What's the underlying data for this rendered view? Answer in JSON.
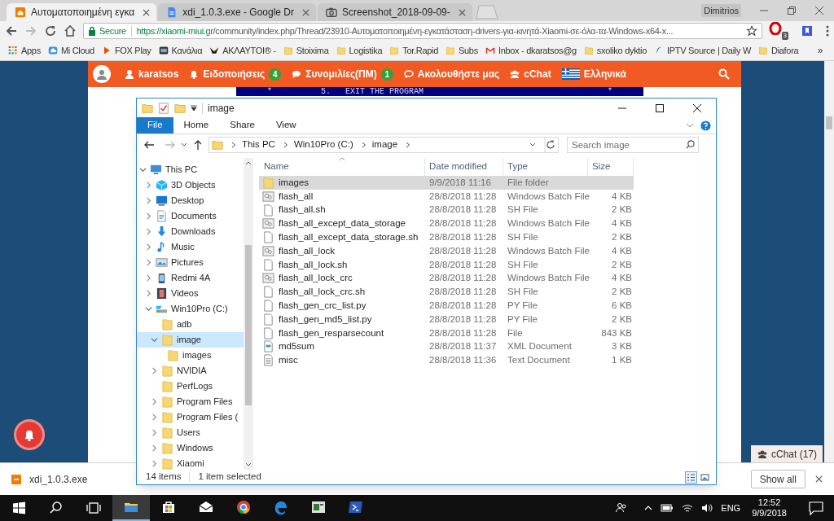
{
  "browser": {
    "tabs": [
      {
        "kind": "site",
        "title": "Αυτοματοποιημένη εγκα",
        "selected": true
      },
      {
        "kind": "document",
        "title": "xdi_1.0.3.exe - Google Dr",
        "selected": false
      },
      {
        "kind": "image",
        "title": "Screenshot_2018-09-09-",
        "selected": false
      }
    ],
    "profile": "Dimitrios",
    "security_label": "Secure",
    "url_host": "https://xiaomi-miui.gr",
    "url_path": "/community/index.php/Thread/23910-Αυτοματοποιημένη-εγκατάσταση-drivers-για-κινητά-Xiaomi-σε-όλα-τα-Windows-x64-x...",
    "extension_badge": "3",
    "bookmarks": [
      {
        "kind": "apps",
        "label": "Apps"
      },
      {
        "kind": "cloud",
        "label": "Mi Cloud"
      },
      {
        "kind": "play",
        "label": "FOX Play"
      },
      {
        "kind": "channel",
        "label": "Κανάλια"
      },
      {
        "kind": "bird",
        "label": "ΑΚΛΑΥΤΟΙ® -"
      },
      {
        "kind": "folder",
        "label": "Stoixima"
      },
      {
        "kind": "folder",
        "label": "Logistika"
      },
      {
        "kind": "folder",
        "label": "Tor.Rapid"
      },
      {
        "kind": "folder",
        "label": "Subs"
      },
      {
        "kind": "mail",
        "label": "Inbox - dkaratsos@g"
      },
      {
        "kind": "folder",
        "label": "sxoliko dyktio"
      },
      {
        "kind": "wave",
        "label": "IPTV Source | Daily W"
      },
      {
        "kind": "folder",
        "label": "Diafora"
      }
    ],
    "bookmarks_more": "»"
  },
  "site_nav": {
    "items": [
      {
        "kind": "user",
        "label": "karatsos"
      },
      {
        "kind": "bell",
        "label": "Ειδοποιήσεις",
        "badge": "4"
      },
      {
        "kind": "chat",
        "label": "Συνομιλίες(ΠΜ)",
        "badge": "1"
      },
      {
        "kind": "follow",
        "label": "Ακολουθήστε μας"
      },
      {
        "kind": "group",
        "label": "cChat"
      },
      {
        "kind": "flag",
        "label": "Ελληνικά"
      }
    ]
  },
  "terminal_line": {
    "left": "*",
    "text": "5.   EXIT THE PROGRAM",
    "right": "*"
  },
  "explorer": {
    "title": "image",
    "ribbon_tabs": [
      {
        "label": "File",
        "selected": true
      },
      {
        "label": "Home",
        "selected": false
      },
      {
        "label": "Share",
        "selected": false
      },
      {
        "label": "View",
        "selected": false
      }
    ],
    "breadcrumb": [
      "This PC",
      "Win10Pro (C:)",
      "image"
    ],
    "search": {
      "placeholder": "Search image"
    },
    "tree": [
      {
        "kind": "pc",
        "label": "This PC",
        "expandable": true,
        "expanded": true,
        "selected": false,
        "children": [
          {
            "kind": "objects",
            "label": "3D Objects",
            "expandable": true,
            "expanded": false,
            "selected": false
          },
          {
            "kind": "desktop",
            "label": "Desktop",
            "expandable": true,
            "expanded": false,
            "selected": false
          },
          {
            "kind": "documents",
            "label": "Documents",
            "expandable": true,
            "expanded": false,
            "selected": false
          },
          {
            "kind": "downloads",
            "label": "Downloads",
            "expandable": true,
            "expanded": false,
            "selected": false
          },
          {
            "kind": "music",
            "label": "Music",
            "expandable": true,
            "expanded": false,
            "selected": false
          },
          {
            "kind": "pictures",
            "label": "Pictures",
            "expandable": true,
            "expanded": false,
            "selected": false
          },
          {
            "kind": "phone",
            "label": "Redmi 4A",
            "expandable": true,
            "expanded": false,
            "selected": false
          },
          {
            "kind": "videos",
            "label": "Videos",
            "expandable": true,
            "expanded": false,
            "selected": false
          },
          {
            "kind": "drive",
            "label": "Win10Pro (C:)",
            "expandable": true,
            "expanded": true,
            "selected": false,
            "children": [
              {
                "kind": "folder",
                "label": "adb",
                "expandable": false,
                "selected": false
              },
              {
                "kind": "folder",
                "label": "image",
                "expandable": true,
                "expanded": true,
                "selected": true,
                "children": [
                  {
                    "kind": "folder",
                    "label": "images",
                    "expandable": false,
                    "selected": false
                  }
                ]
              },
              {
                "kind": "folder",
                "label": "NVIDIA",
                "expandable": true,
                "expanded": false,
                "selected": false
              },
              {
                "kind": "folder",
                "label": "PerfLogs",
                "expandable": false,
                "selected": false
              },
              {
                "kind": "folder",
                "label": "Program Files",
                "expandable": true,
                "expanded": false,
                "selected": false
              },
              {
                "kind": "folder",
                "label": "Program Files (",
                "expandable": true,
                "expanded": false,
                "selected": false
              },
              {
                "kind": "folder",
                "label": "Users",
                "expandable": true,
                "expanded": false,
                "selected": false
              },
              {
                "kind": "folder",
                "label": "Windows",
                "expandable": true,
                "expanded": false,
                "selected": false
              },
              {
                "kind": "folder",
                "label": "Xiaomi",
                "expandable": true,
                "expanded": false,
                "selected": false
              }
            ]
          }
        ]
      }
    ],
    "columns": [
      "Name",
      "Date modified",
      "Type",
      "Size"
    ],
    "rows": [
      {
        "kind": "folder",
        "name": "images",
        "date": "9/9/2018 11:16",
        "type": "File folder",
        "size": "",
        "selected": true
      },
      {
        "kind": "batch",
        "name": "flash_all",
        "date": "28/8/2018 11:28",
        "type": "Windows Batch File",
        "size": "4 KB",
        "selected": false
      },
      {
        "kind": "file",
        "name": "flash_all.sh",
        "date": "28/8/2018 11:28",
        "type": "SH File",
        "size": "2 KB",
        "selected": false
      },
      {
        "kind": "batch",
        "name": "flash_all_except_data_storage",
        "date": "28/8/2018 11:28",
        "type": "Windows Batch File",
        "size": "4 KB",
        "selected": false
      },
      {
        "kind": "file",
        "name": "flash_all_except_data_storage.sh",
        "date": "28/8/2018 11:28",
        "type": "SH File",
        "size": "2 KB",
        "selected": false
      },
      {
        "kind": "batch",
        "name": "flash_all_lock",
        "date": "28/8/2018 11:28",
        "type": "Windows Batch File",
        "size": "4 KB",
        "selected": false
      },
      {
        "kind": "file",
        "name": "flash_all_lock.sh",
        "date": "28/8/2018 11:28",
        "type": "SH File",
        "size": "2 KB",
        "selected": false
      },
      {
        "kind": "batch",
        "name": "flash_all_lock_crc",
        "date": "28/8/2018 11:28",
        "type": "Windows Batch File",
        "size": "4 KB",
        "selected": false
      },
      {
        "kind": "file",
        "name": "flash_all_lock_crc.sh",
        "date": "28/8/2018 11:28",
        "type": "SH File",
        "size": "2 KB",
        "selected": false
      },
      {
        "kind": "file",
        "name": "flash_gen_crc_list.py",
        "date": "28/8/2018 11:28",
        "type": "PY File",
        "size": "6 KB",
        "selected": false
      },
      {
        "kind": "file",
        "name": "flash_gen_md5_list.py",
        "date": "28/8/2018 11:28",
        "type": "PY File",
        "size": "2 KB",
        "selected": false
      },
      {
        "kind": "file",
        "name": "flash_gen_resparsecount",
        "date": "28/8/2018 11:28",
        "type": "File",
        "size": "843 KB",
        "selected": false
      },
      {
        "kind": "xml",
        "name": "md5sum",
        "date": "28/8/2018 11:37",
        "type": "XML Document",
        "size": "3 KB",
        "selected": false
      },
      {
        "kind": "text",
        "name": "misc",
        "date": "28/8/2018 11:36",
        "type": "Text Document",
        "size": "1 KB",
        "selected": false
      }
    ],
    "status": {
      "count": "14 items",
      "selection": "1 item selected"
    },
    "view_buttons": [
      {
        "kind": "details",
        "selected": true
      },
      {
        "kind": "thumbnails",
        "selected": false
      }
    ]
  },
  "chat_button": "cChat (17)",
  "download_bar": {
    "file": "xdi_1.0.3.exe",
    "show_all": "Show all"
  },
  "taskbar": {
    "apps": [
      {
        "kind": "explorer",
        "active": true
      },
      {
        "kind": "store",
        "active": false
      },
      {
        "kind": "mail",
        "active": false
      },
      {
        "kind": "chrome",
        "active": false
      },
      {
        "kind": "edge",
        "active": false
      },
      {
        "kind": "app",
        "active": false
      },
      {
        "kind": "powershell",
        "active": false
      }
    ],
    "language": "ENG",
    "time": "12:52",
    "date": "9/9/2018"
  }
}
